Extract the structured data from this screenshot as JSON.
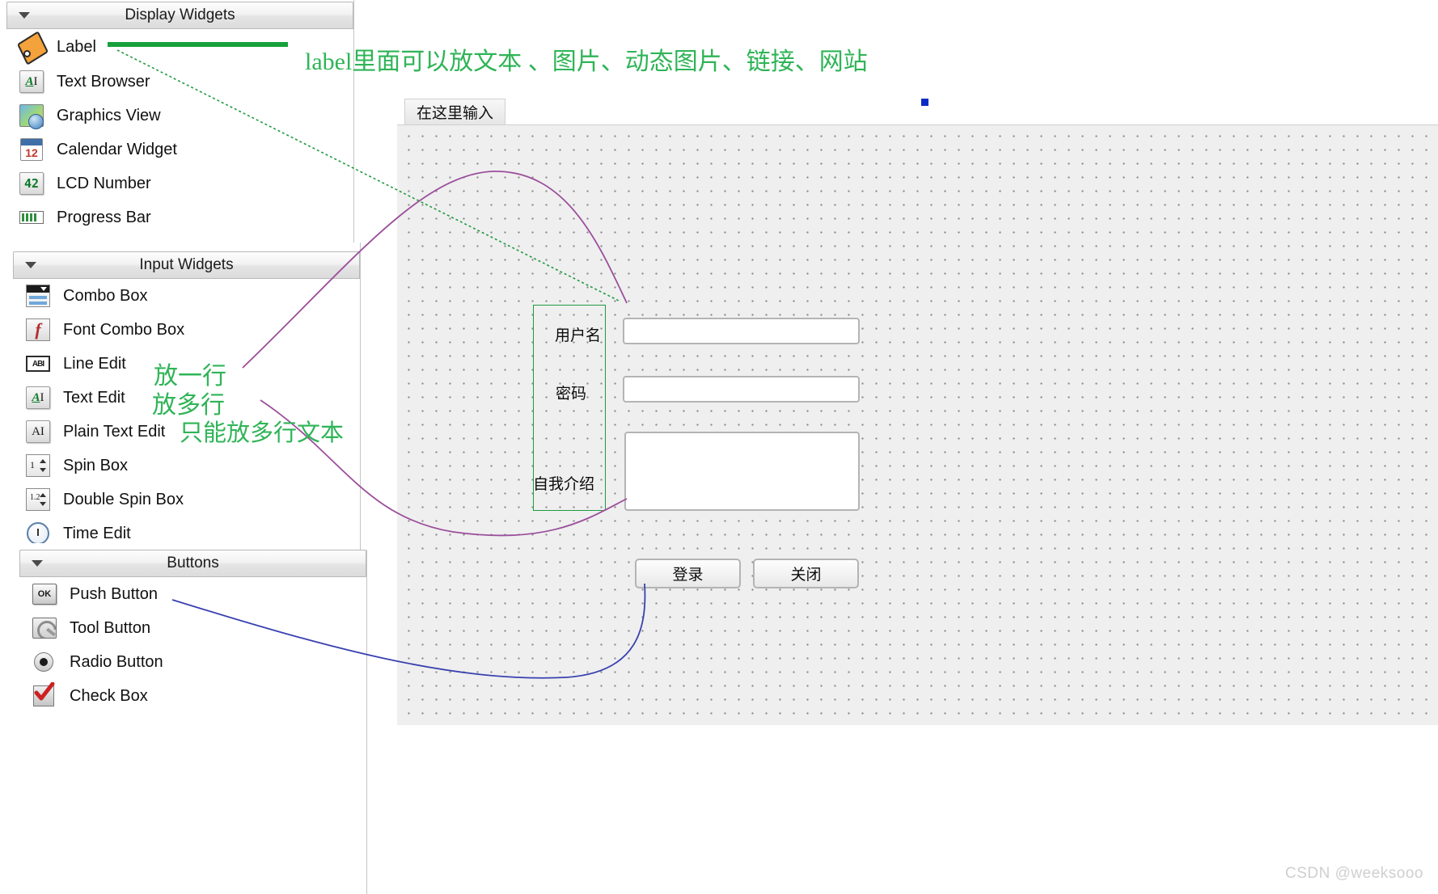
{
  "colors": {
    "annotation_green": "#2fb457",
    "arrow_green": "#1f9a40",
    "arrow_purple": "#9b4f9b",
    "arrow_blue": "#3840b0",
    "label_outline_green": "#1f9a40",
    "handle_blue": "#0b2cc4",
    "canvas_bg": "#efefef",
    "watermark": "#cfcfcf"
  },
  "widget_box": {
    "groups": [
      {
        "title": "Display Widgets",
        "caret_icon": "chevron-down-icon",
        "items": [
          {
            "label": "Label",
            "icon": "label-tag-icon"
          },
          {
            "label": "Text Browser",
            "icon": "text-browser-icon"
          },
          {
            "label": "Graphics View",
            "icon": "graphics-view-icon"
          },
          {
            "label": "Calendar Widget",
            "icon": "calendar-icon",
            "icon_text": "12"
          },
          {
            "label": "LCD Number",
            "icon": "lcd-number-icon",
            "icon_text": "42"
          },
          {
            "label": "Progress Bar",
            "icon": "progress-bar-icon"
          }
        ]
      },
      {
        "title": "Input Widgets",
        "caret_icon": "chevron-down-icon",
        "items": [
          {
            "label": "Combo Box",
            "icon": "combo-box-icon"
          },
          {
            "label": "Font Combo Box",
            "icon": "font-combo-box-icon"
          },
          {
            "label": "Line Edit",
            "icon": "line-edit-icon",
            "icon_text": "ABI"
          },
          {
            "label": "Text Edit",
            "icon": "text-edit-icon",
            "icon_text": "AI"
          },
          {
            "label": "Plain Text Edit",
            "icon": "plain-text-edit-icon",
            "icon_text": "AI"
          },
          {
            "label": "Spin Box",
            "icon": "spin-box-icon",
            "icon_text": "1"
          },
          {
            "label": "Double Spin Box",
            "icon": "double-spin-box-icon",
            "icon_text": "1.2"
          },
          {
            "label": "Time Edit",
            "icon": "time-edit-icon"
          }
        ]
      },
      {
        "title": "Buttons",
        "caret_icon": "chevron-down-icon",
        "items": [
          {
            "label": "Push Button",
            "icon": "push-button-icon",
            "icon_text": "OK"
          },
          {
            "label": "Tool Button",
            "icon": "tool-button-icon"
          },
          {
            "label": "Radio Button",
            "icon": "radio-button-icon"
          },
          {
            "label": "Check Box",
            "icon": "check-box-icon"
          }
        ]
      }
    ]
  },
  "annotations": {
    "top_note": "label里面可以放文本 、图片、动态图片、链接、网站",
    "line_edit_note": "放一行",
    "text_edit_note": "放多行",
    "plain_text_edit_note": "只能放多行文本"
  },
  "designer": {
    "tab_label": "在这里输入",
    "form": {
      "labels": [
        "用户名",
        "密码",
        "自我介绍"
      ],
      "fields": [
        {
          "name": "username-input",
          "value": "",
          "type": "line-edit"
        },
        {
          "name": "password-input",
          "value": "",
          "type": "line-edit"
        },
        {
          "name": "self-intro-input",
          "value": "",
          "type": "text-edit"
        }
      ],
      "buttons": [
        {
          "name": "login-button",
          "label": "登录"
        },
        {
          "name": "close-button",
          "label": "关闭"
        }
      ]
    }
  },
  "watermark": "CSDN @weeksooo"
}
